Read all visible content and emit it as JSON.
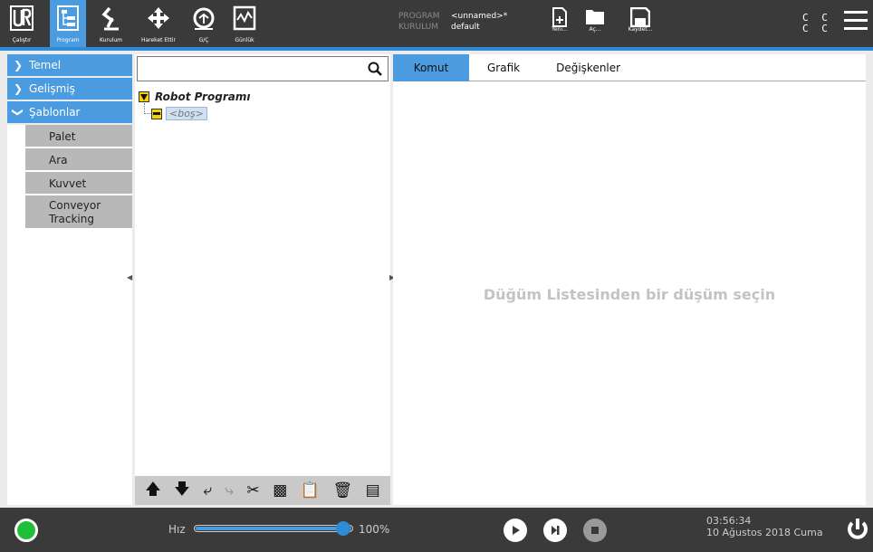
{
  "topbar": {
    "nav": [
      {
        "label": "Çalıştır",
        "icon": "ur-logo-icon"
      },
      {
        "label": "Program",
        "icon": "program-tree-icon",
        "active": true
      },
      {
        "label": "Kurulum",
        "icon": "robot-arm-icon"
      },
      {
        "label": "Hareket Ettir",
        "icon": "move-arrows-icon"
      },
      {
        "label": "G/Ç",
        "icon": "io-icon"
      },
      {
        "label": "Günlük",
        "icon": "log-chart-icon"
      }
    ],
    "program_key": "PROGRAM",
    "program_value": "<unnamed>*",
    "installation_key": "KURULUM",
    "installation_value": "default",
    "file_buttons": [
      {
        "label": "Yeni...",
        "icon": "new-file-icon"
      },
      {
        "label": "Aç...",
        "icon": "open-folder-icon"
      },
      {
        "label": "Kaydet...",
        "icon": "save-icon"
      }
    ],
    "cc_row1": "C C",
    "cc_row2": "C C"
  },
  "sidebar": {
    "categories": [
      {
        "label": "Temel",
        "expanded": false
      },
      {
        "label": "Gelişmiş",
        "expanded": false
      },
      {
        "label": "Şablonlar",
        "expanded": true
      }
    ],
    "templates": [
      "Palet",
      "Ara",
      "Kuvvet",
      "Conveyor Tracking"
    ]
  },
  "tree": {
    "search_placeholder": "",
    "root_label": "Robot Programı",
    "empty_node_label": "<boş>",
    "toolbar_icons": [
      "move-up-icon",
      "move-down-icon",
      "undo-icon",
      "redo-icon",
      "cut-icon",
      "copy-icon",
      "paste-icon",
      "delete-icon",
      "suppress-icon"
    ]
  },
  "main": {
    "tabs": [
      "Komut",
      "Grafik",
      "Değişkenler"
    ],
    "active_tab": "Komut",
    "placeholder": "Düğüm Listesinden bir düşüm seçin"
  },
  "bottombar": {
    "speed_label": "Hız",
    "speed_value": "100%",
    "speed_fraction": 1.0,
    "time": "03:56:34",
    "date": "10 Ağustos 2018 Cuma"
  },
  "colors": {
    "accent": "#4a9be0",
    "status_green": "#1fbf3a",
    "tree_node_yellow": "#f7d20b",
    "topbar_bg": "#3a3a3a"
  }
}
